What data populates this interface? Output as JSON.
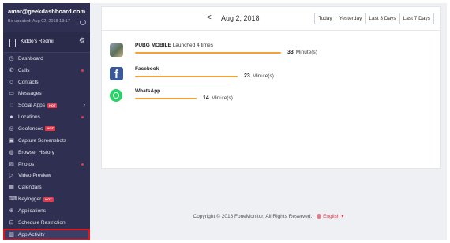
{
  "account": {
    "email": "amar@geekdashboard.com",
    "updated": "Be updated: Aug 02, 2018 13:17"
  },
  "device": {
    "name": "Kiddo's Redmi"
  },
  "nav": [
    {
      "label": "Dashboard",
      "icon": "dashboard-icon"
    },
    {
      "label": "Calls",
      "icon": "phone-icon",
      "dot": true
    },
    {
      "label": "Contacts",
      "icon": "contacts-icon"
    },
    {
      "label": "Messages",
      "icon": "message-icon"
    },
    {
      "label": "Social Apps",
      "icon": "chat-bubble-icon",
      "hot": "HOT",
      "chevron": true
    },
    {
      "label": "Locations",
      "icon": "location-pin-icon",
      "dot": true
    },
    {
      "label": "Geofences",
      "icon": "geofence-icon",
      "hot": "HOT"
    },
    {
      "label": "Capture Screenshots",
      "icon": "screenshot-icon"
    },
    {
      "label": "Browser History",
      "icon": "browser-icon"
    },
    {
      "label": "Photos",
      "icon": "photo-icon",
      "dot": true
    },
    {
      "label": "Video Preview",
      "icon": "video-icon"
    },
    {
      "label": "Calendars",
      "icon": "calendar-icon"
    },
    {
      "label": "Keylogger",
      "icon": "keyboard-icon",
      "hot": "HOT"
    },
    {
      "label": "Applications",
      "icon": "applications-icon"
    },
    {
      "label": "Schedule Restriction",
      "icon": "schedule-icon"
    },
    {
      "label": "App Activity",
      "icon": "chart-icon",
      "active": true
    }
  ],
  "datebar": {
    "prev": "<",
    "date": "Aug 2, 2018",
    "ranges": [
      "Today",
      "Yesterday",
      "Last 3 Days",
      "Last 7 Days"
    ]
  },
  "apps": [
    {
      "name": "PUBG MOBILE",
      "launch": "Launched 4 times",
      "minutes": "33",
      "unit": "Minute(s)",
      "fraction": 1.0
    },
    {
      "name": "Facebook",
      "launch": "",
      "minutes": "23",
      "unit": "Minute(s)",
      "fraction": 0.7
    },
    {
      "name": "WhatsApp",
      "launch": "",
      "minutes": "14",
      "unit": "Minute(s)",
      "fraction": 0.42
    }
  ],
  "footer": {
    "copyright": "Copyright © 2018 FoneMonitor. All Rights Reserved.",
    "language": "English"
  },
  "colors": {
    "sidebar": "#2f3051",
    "accent_bar": "#f4a13a",
    "highlight": "#e3151a",
    "badge": "#e5384a"
  }
}
